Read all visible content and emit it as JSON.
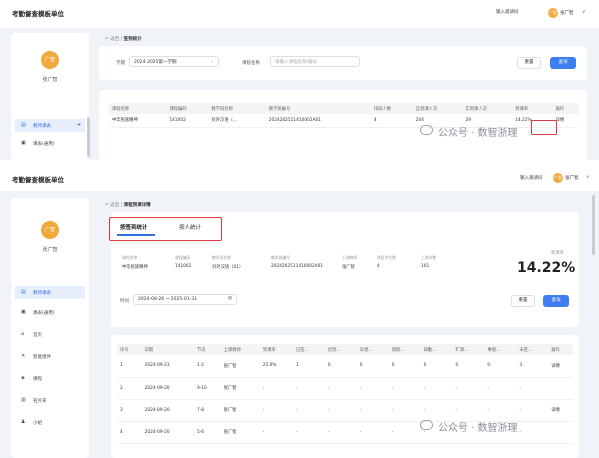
{
  "panel1": {
    "org_title": "考勤督查模板单位",
    "header": {
      "invite": "输入邀请码",
      "avatar": "广智",
      "user": "张广智",
      "chevron": "∨"
    },
    "sidebar": {
      "avatar": "广智",
      "name": "张广智",
      "items": [
        {
          "label": "教师课表",
          "active": true,
          "icon": "teacher-icon"
        },
        {
          "label": "课表(通用)",
          "active": false,
          "icon": "calendar-icon"
        }
      ]
    },
    "breadcrumb": {
      "back": "返回",
      "sep": "|",
      "current": "签到统计"
    },
    "filters": {
      "term_label": "学期",
      "term_value": "2024-2025第一学期",
      "course_label": "课程名称",
      "course_placeholder": "请输入课程名称/编号"
    },
    "buttons": {
      "reset": "重置",
      "query": "查询"
    },
    "table": {
      "headers": [
        "课程名称",
        "课程编码",
        "教学班名称",
        "教学班编号",
        "排班人数",
        "应到课人次",
        "实到课人次",
        "到课率",
        "操作"
      ],
      "rows": [
        [
          "中华民族精神",
          "141002",
          "对外汉语（…",
          "2024202511410002A01",
          "4",
          "204",
          "29",
          "14.22%",
          "详情"
        ]
      ]
    }
  },
  "panel2": {
    "org_title": "考勤督查模板单位",
    "header": {
      "invite": "输入邀请码",
      "avatar": "广智",
      "user": "张广智",
      "chevron": "∨"
    },
    "sidebar": {
      "avatar": "广智",
      "name": "张广智",
      "items": [
        {
          "label": "教师课表",
          "active": true,
          "icon": "teacher-icon"
        },
        {
          "label": "课表(通用)",
          "active": false,
          "icon": "calendar-icon"
        },
        {
          "label": "首页",
          "active": false,
          "icon": "home-icon"
        },
        {
          "label": "智能组件",
          "active": false,
          "icon": "tools-icon"
        },
        {
          "label": "课程",
          "active": false,
          "icon": "shield-icon"
        },
        {
          "label": "名片夹",
          "active": false,
          "icon": "folder-icon"
        },
        {
          "label": "小组",
          "active": false,
          "icon": "user-icon"
        }
      ]
    },
    "breadcrumb": {
      "back": "返回",
      "sep": "|",
      "current": "课程到课详情"
    },
    "tabs": [
      {
        "label": "按签到统计",
        "active": true
      },
      {
        "label": "按人统计",
        "active": false
      }
    ],
    "info": {
      "headers": [
        "课程名称",
        "课程编码",
        "教学班名称",
        "教学班编号",
        "上课教师",
        "排班学生数",
        "上课次数"
      ],
      "values": [
        "中华民族精神",
        "141002",
        "对外汉语（01）",
        "2024202511410002A01",
        "张广智",
        "4",
        "101"
      ]
    },
    "rate": {
      "label": "到课率",
      "value": "14.22%"
    },
    "filters": {
      "time_label": "时间",
      "time_value": "2024-08-26 ~ 2025-01-31"
    },
    "buttons": {
      "reset": "重置",
      "query": "查询"
    },
    "table": {
      "headers": [
        "序号",
        "日期",
        "节次",
        "上课教师",
        "到课率",
        "已签…",
        "迟到…",
        "早退…",
        "请假…",
        "缺勤…",
        "旷课…",
        "事假…",
        "未签…",
        "操作"
      ],
      "rows": [
        [
          "1",
          "2024-09-23",
          "1-2",
          "张广智",
          "25.0%",
          "1",
          "0",
          "0",
          "0",
          "0",
          "0",
          "0",
          "3",
          "详情"
        ],
        [
          "2",
          "2024-09-20",
          "9-10",
          "张广智",
          "-",
          "-",
          "-",
          "-",
          "-",
          "-",
          "-",
          "-",
          "-",
          ""
        ],
        [
          "3",
          "2024-09-20",
          "7-8",
          "张广智",
          "-",
          "-",
          "-",
          "-",
          "-",
          "-",
          "-",
          "-",
          "-",
          "详情"
        ],
        [
          "4",
          "2024-09-20",
          "5-6",
          "张广智",
          "-",
          "-",
          "-",
          "-",
          "-",
          "-",
          "-",
          "-",
          "-",
          ""
        ]
      ]
    }
  },
  "watermark": {
    "text": "公众号 · 数智浙理"
  },
  "colors": {
    "accent": "#3d7ef0",
    "highlight": "#e03a3a",
    "avatar": "#f0a93b"
  }
}
